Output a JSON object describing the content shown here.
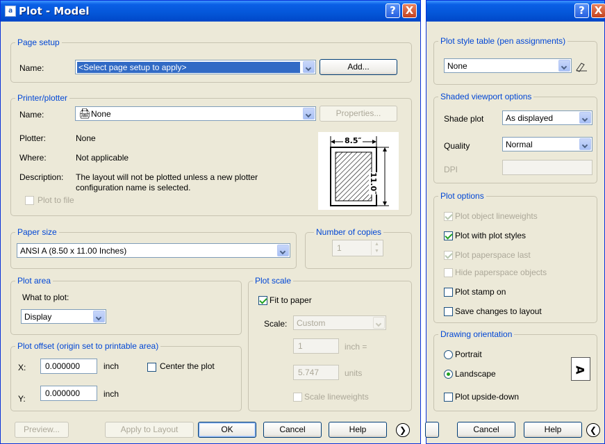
{
  "window": {
    "title": "Plot - Model",
    "help_label": "?",
    "close_label": "X"
  },
  "page_setup": {
    "legend": "Page setup",
    "name_label": "Name:",
    "name_value": "<Select page setup to apply>",
    "add_button": "Add..."
  },
  "printer": {
    "legend": "Printer/plotter",
    "name_label": "Name:",
    "name_value": "None",
    "properties_button": "Properties...",
    "plotter_label": "Plotter:",
    "plotter_value": "None",
    "where_label": "Where:",
    "where_value": "Not applicable",
    "description_label": "Description:",
    "description_line1": "The layout will not be plotted unless a new plotter",
    "description_line2": "configuration name is selected.",
    "plot_to_file": "Plot to file",
    "paper_width": "8.5″",
    "paper_height": "11.0″"
  },
  "paper_size": {
    "legend": "Paper size",
    "value": "ANSI A (8.50 x 11.00 Inches)"
  },
  "copies": {
    "legend": "Number of copies",
    "value": "1"
  },
  "plot_area": {
    "legend": "Plot area",
    "what_label": "What to plot:",
    "what_value": "Display"
  },
  "plot_offset": {
    "legend": "Plot offset (origin set to printable area)",
    "x_label": "X:",
    "x_value": "0.000000",
    "x_unit": "inch",
    "y_label": "Y:",
    "y_value": "0.000000",
    "y_unit": "inch",
    "center_label": "Center the plot"
  },
  "plot_scale": {
    "legend": "Plot scale",
    "fit_label": "Fit to paper",
    "scale_label": "Scale:",
    "scale_value": "Custom",
    "inch_value": "1",
    "inch_unit": "inch =",
    "units_value": "5.747",
    "units_unit": "units",
    "lineweights_label": "Scale lineweights"
  },
  "buttons": {
    "preview": "Preview...",
    "apply": "Apply to Layout",
    "ok": "OK",
    "cancel": "Cancel",
    "help": "Help",
    "more_icon": "❯",
    "less_icon": "❮"
  },
  "right": {
    "pen": {
      "legend": "Plot style table (pen assignments)",
      "value": "None"
    },
    "shaded": {
      "legend": "Shaded viewport options",
      "shade_label": "Shade plot",
      "shade_value": "As displayed",
      "quality_label": "Quality",
      "quality_value": "Normal",
      "dpi_label": "DPI"
    },
    "options": {
      "legend": "Plot options",
      "items": [
        "Plot object lineweights",
        "Plot with plot styles",
        "Plot paperspace last",
        "Hide paperspace objects",
        "Plot stamp on",
        "Save changes to layout"
      ]
    },
    "orientation": {
      "legend": "Drawing orientation",
      "portrait": "Portrait",
      "landscape": "Landscape",
      "upside": "Plot upside-down",
      "preview_glyph": "A"
    }
  },
  "colors": {
    "title_bar": "#0a5fe6",
    "legend_text": "#0046d5",
    "selection": "#316ac5"
  }
}
